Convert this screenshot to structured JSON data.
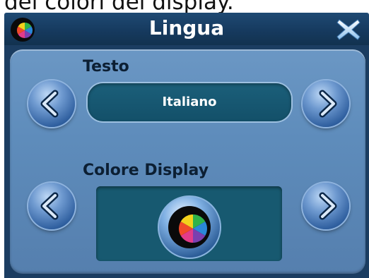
{
  "caption": {
    "text": "dei colori del display."
  },
  "header": {
    "title": "Lingua",
    "logo_icon": "color-wheel-logo-icon",
    "close_icon": "close-x-icon"
  },
  "language": {
    "label": "Testo",
    "value": "Italiano",
    "prev_icon": "chevron-left-icon",
    "next_icon": "chevron-right-icon"
  },
  "display_color": {
    "label": "Colore Display",
    "preview_icon": "color-wheel-logo-icon",
    "prev_icon": "chevron-left-icon",
    "next_icon": "chevron-right-icon"
  },
  "colors": {
    "title_bar": "#163a5f",
    "panel": "#5e8cbb",
    "field": "#135069",
    "button": "#2f5f9f"
  }
}
